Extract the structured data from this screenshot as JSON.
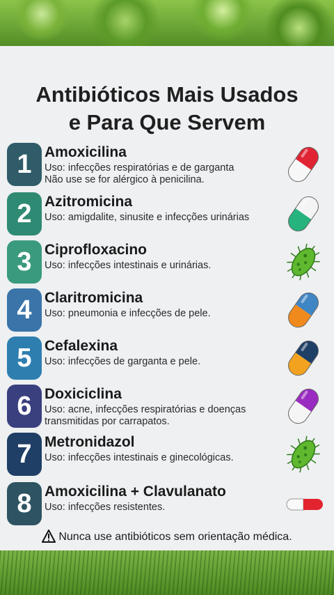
{
  "title_line1": "Antibióticos Mais Usados",
  "title_line2": "e Para Que Servem",
  "items": [
    {
      "num": "1",
      "name": "Amoxicilina",
      "desc1": "Uso: infecções respiratórias e de garganta",
      "desc2": "Não use se for alérgico à penicilina.",
      "color": "#2f5c68",
      "icon": "pill-red-white-icon"
    },
    {
      "num": "2",
      "name": "Azitromicina",
      "desc1": "Uso: amigdalite, sinusite e infecções urinárias",
      "desc2": "",
      "color": "#2f8a73",
      "icon": "pill-green-white-icon"
    },
    {
      "num": "3",
      "name": "Ciprofloxacino",
      "desc1": "Uso: infecções intestinais e urinárias.",
      "desc2": "",
      "color": "#3a9a7e",
      "icon": "bacteria-icon"
    },
    {
      "num": "4",
      "name": "Claritromicina",
      "desc1": "Uso: pneumonia e infecções de pele.",
      "desc2": "",
      "color": "#3a74a8",
      "icon": "pill-blue-orange-icon"
    },
    {
      "num": "5",
      "name": "Cefalexina",
      "desc1": "Uso: infecções de garganta e pele.",
      "desc2": "",
      "color": "#2e7fb0",
      "icon": "pill-navy-orange-icon"
    },
    {
      "num": "6",
      "name": "Doxiciclina",
      "desc1": "Uso: acne, infecções respiratórias e doenças",
      "desc2": "transmitidas por carrapatos.",
      "color": "#3a3f7e",
      "icon": "pill-purple-white-icon"
    },
    {
      "num": "7",
      "name": "Metronidazol",
      "desc1": "Uso: infecções intestinais e ginecológicas.",
      "desc2": "",
      "color": "#1f3f66",
      "icon": "bacteria-icon"
    },
    {
      "num": "8",
      "name": "Amoxicilina + Clavulanato",
      "desc1": "Uso: infecções resistentes.",
      "desc2": "",
      "color": "#2e5362",
      "icon": "pill-red-white-icon"
    }
  ],
  "warning": "Nunca use antibióticos sem orientação médica."
}
